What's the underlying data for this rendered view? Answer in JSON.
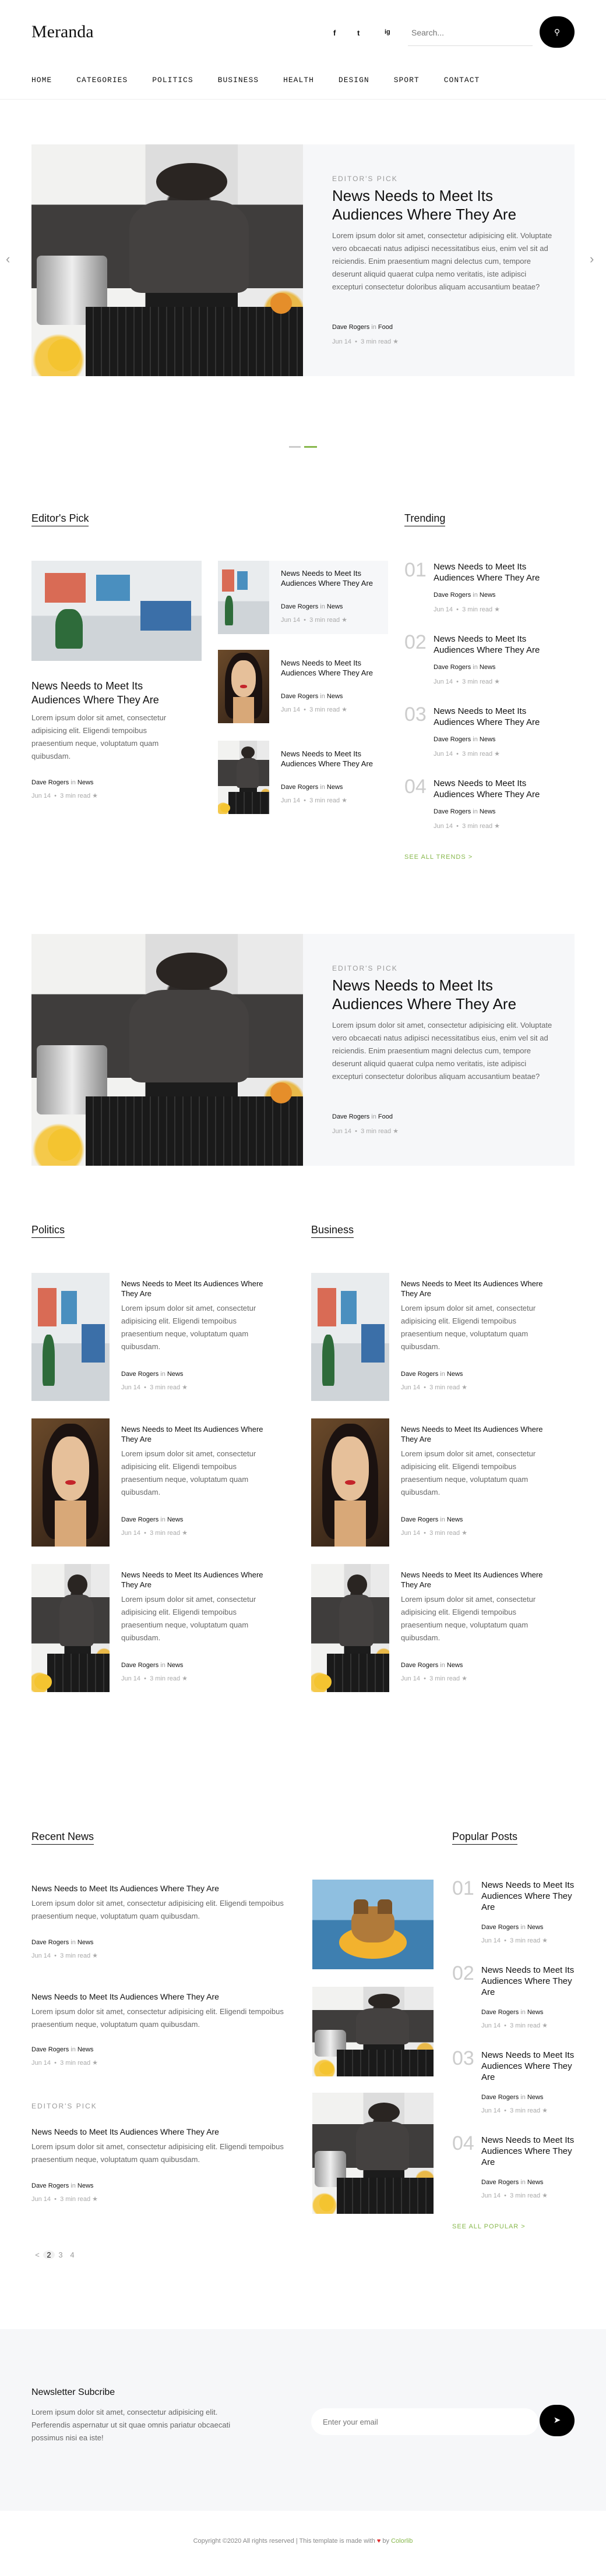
{
  "site": {
    "logo": "Meranda",
    "search_placeholder": "Search...",
    "search_icon": "search-icon"
  },
  "social": [
    "f",
    "t",
    "ig"
  ],
  "nav": [
    "HOME",
    "CATEGORIES",
    "POLITICS",
    "BUSINESS",
    "HEALTH",
    "DESIGN",
    "SPORT",
    "CONTACT"
  ],
  "hero": {
    "kicker": "EDITOR'S PICK",
    "title": "News Needs to Meet Its Audiences Where They Are",
    "body": "Lorem ipsum dolor sit amet, consectetur adipisicing elit. Voluptate vero obcaecati natus adipisci necessitatibus eius, enim vel sit ad reiciendis. Enim praesentium magni delectus cum, tempore deserunt aliquid quaerat culpa nemo veritatis, iste adipisci excepturi consectetur doloribus aliquam accusantium beatae?",
    "author": "Dave Rogers",
    "in": "in",
    "category": "Food",
    "date": "Jun 14",
    "read": "3 min read",
    "star": "★"
  },
  "editors_pick": {
    "heading": "Editor's Pick",
    "main": {
      "title": "News Needs to Meet Its Audiences Where They Are",
      "body": "Lorem ipsum dolor sit amet, consectetur adipisicing elit. Eligendi tempoibus praesentium neque, voluptatum quam quibusdam.",
      "author": "Dave Rogers",
      "category": "News",
      "date": "Jun 14",
      "read": "3 min read"
    },
    "side": [
      {
        "title": "News Needs to Meet Its Audiences Where They Are",
        "author": "Dave Rogers",
        "category": "News",
        "date": "Jun 14",
        "read": "3 min read"
      },
      {
        "title": "News Needs to Meet Its Audiences Where They Are",
        "author": "Dave Rogers",
        "category": "News",
        "date": "Jun 14",
        "read": "3 min read"
      },
      {
        "title": "News Needs to Meet Its Audiences Where They Are",
        "author": "Dave Rogers",
        "category": "News",
        "date": "Jun 14",
        "read": "3 min read"
      }
    ]
  },
  "trending": {
    "heading": "Trending",
    "items": [
      {
        "num": "01",
        "title": "News Needs to Meet Its Audiences Where They Are",
        "author": "Dave Rogers",
        "category": "News",
        "date": "Jun 14",
        "read": "3 min read"
      },
      {
        "num": "02",
        "title": "News Needs to Meet Its Audiences Where They Are",
        "author": "Dave Rogers",
        "category": "News",
        "date": "Jun 14",
        "read": "3 min read"
      },
      {
        "num": "03",
        "title": "News Needs to Meet Its Audiences Where They Are",
        "author": "Dave Rogers",
        "category": "News",
        "date": "Jun 14",
        "read": "3 min read"
      },
      {
        "num": "04",
        "title": "News Needs to Meet Its Audiences Where They Are",
        "author": "Dave Rogers",
        "category": "News",
        "date": "Jun 14",
        "read": "3 min read"
      }
    ],
    "see_all": "SEE ALL TRENDS >"
  },
  "feature2": {
    "kicker": "EDITOR'S PICK",
    "title": "News Needs to Meet Its Audiences Where They Are",
    "body": "Lorem ipsum dolor sit amet, consectetur adipisicing elit. Voluptate vero obcaecati natus adipisci necessitatibus eius, enim vel sit ad reiciendis. Enim praesentium magni delectus cum, tempore deserunt aliquid quaerat culpa nemo veritatis, iste adipisci excepturi consectetur doloribus aliquam accusantium beatae?",
    "author": "Dave Rogers",
    "category": "Food",
    "date": "Jun 14",
    "read": "3 min read"
  },
  "politics": {
    "heading": "Politics"
  },
  "business": {
    "heading": "Business"
  },
  "card": {
    "title": "News Needs to Meet Its Audiences Where They Are",
    "body": "Lorem ipsum dolor sit amet, consectetur adipisicing elit. Eligendi tempoibus praesentium neque, voluptatum quam quibusdam.",
    "author": "Dave Rogers",
    "category": "News",
    "date": "Jun 14",
    "read": "3 min read"
  },
  "recent": {
    "heading": "Recent News",
    "items": [
      {
        "title": "News Needs to Meet Its Audiences Where They Are",
        "body": "Lorem ipsum dolor sit amet, consectetur adipisicing elit. Eligendi tempoibus praesentium neque, voluptatum quam quibusdam.",
        "author": "Dave Rogers",
        "category": "News",
        "date": "Jun 14",
        "read": "3 min read"
      },
      {
        "title": "News Needs to Meet Its Audiences Where They Are",
        "body": "Lorem ipsum dolor sit amet, consectetur adipisicing elit. Eligendi tempoibus praesentium neque, voluptatum quam quibusdam.",
        "author": "Dave Rogers",
        "category": "News",
        "date": "Jun 14",
        "read": "3 min read"
      },
      {
        "kicker": "EDITOR'S PICK",
        "title": "News Needs to Meet Its Audiences Where They Are",
        "body": "Lorem ipsum dolor sit amet, consectetur adipisicing elit. Eligendi tempoibus praesentium neque, voluptatum quam quibusdam.",
        "author": "Dave Rogers",
        "category": "News",
        "date": "Jun 14",
        "read": "3 min read"
      }
    ],
    "pages": [
      "<",
      "2",
      "3",
      "4"
    ]
  },
  "popular": {
    "heading": "Popular Posts",
    "items": [
      {
        "num": "01",
        "title": "News Needs to Meet Its Audiences Where They Are",
        "author": "Dave Rogers",
        "category": "News",
        "date": "Jun 14",
        "read": "3 min read"
      },
      {
        "num": "02",
        "title": "News Needs to Meet Its Audiences Where They Are",
        "author": "Dave Rogers",
        "category": "News",
        "date": "Jun 14",
        "read": "3 min read"
      },
      {
        "num": "03",
        "title": "News Needs to Meet Its Audiences Where They Are",
        "author": "Dave Rogers",
        "category": "News",
        "date": "Jun 14",
        "read": "3 min read"
      },
      {
        "num": "04",
        "title": "News Needs to Meet Its Audiences Where They Are",
        "author": "Dave Rogers",
        "category": "News",
        "date": "Jun 14",
        "read": "3 min read"
      }
    ],
    "see_all": "SEE ALL POPULAR >"
  },
  "newsletter": {
    "heading": "Newsletter Subcribe",
    "body": "Lorem ipsum dolor sit amet, consectetur adipisicing elit. Perferendis aspernatur ut sit quae omnis pariatur obcaecati possimus nisi ea iste!",
    "placeholder": "Enter your email"
  },
  "footer": {
    "copyright": "Copyright ©2020 All rights reserved | This template is made with",
    "by": "by",
    "brand": "Colorlib",
    "heart": "♥"
  },
  "colors": {
    "accent": "#88b84d",
    "dark": "#000000",
    "panel": "#f6f7f9"
  }
}
